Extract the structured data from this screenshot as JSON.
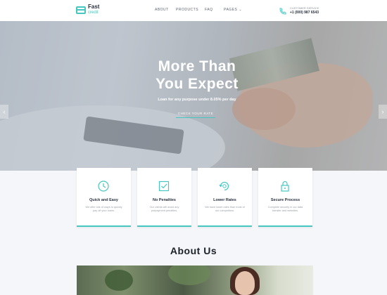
{
  "header": {
    "logo_line1": "Fast",
    "logo_line2": "credit",
    "nav": [
      "ABOUT",
      "PRODUCTS",
      "FAQ",
      "PAGES"
    ],
    "contact_label": "CUSTOMER SERVICE",
    "contact_phone": "+1 (000) 987 6543"
  },
  "hero": {
    "title_line1": "More Than",
    "title_line2": "You Expect",
    "subtitle": "Loan for any purpose under 8.05% per day",
    "button": "CHECK YOUR RATE",
    "prev_arrow": "‹",
    "next_arrow": "›"
  },
  "features": [
    {
      "title": "Quick and Easy",
      "text": "We offer lots of ways to quickly pay off your loans.",
      "icon": "clock-icon"
    },
    {
      "title": "No Penalties",
      "text": "Our clients will avoid any prepayment penalties.",
      "icon": "checkbox-icon"
    },
    {
      "title": "Lower Rates",
      "text": "We have lower rates than most of our competitors.",
      "icon": "refresh-icon"
    },
    {
      "title": "Secure Process",
      "text": "Complete security in our data transfer and websites.",
      "icon": "lock-icon"
    }
  ],
  "about": {
    "title": "About Us"
  },
  "colors": {
    "accent": "#46c7c2",
    "dark": "#283041",
    "background": "#f4f6f9"
  }
}
